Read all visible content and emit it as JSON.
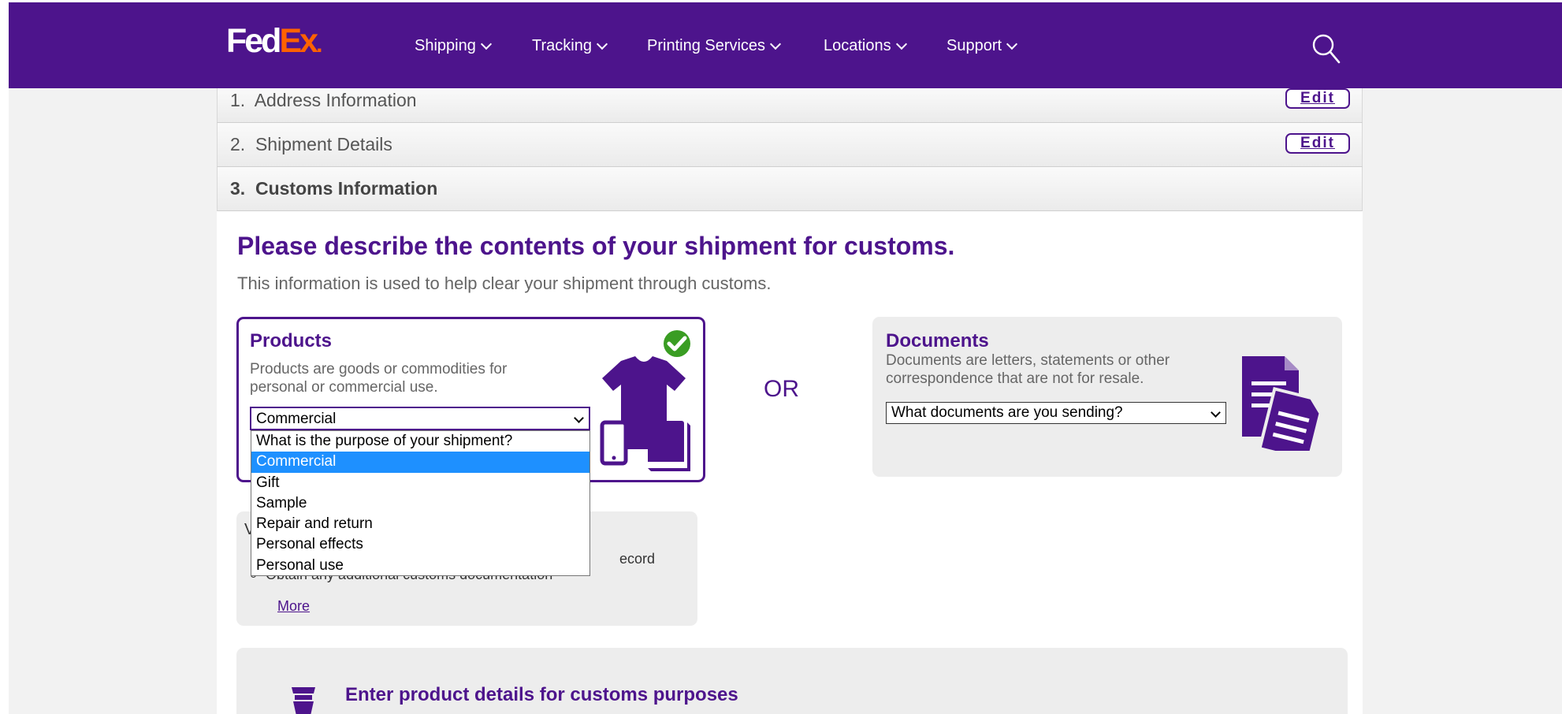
{
  "header": {
    "logo": {
      "fed": "Fed",
      "ex": "Ex",
      "dot": "."
    },
    "nav": [
      "Shipping",
      "Tracking",
      "Printing Services",
      "Locations",
      "Support"
    ],
    "brand_color": "#4d148c",
    "accent_color": "#ff6200",
    "search_icon": "search-icon"
  },
  "steps": [
    {
      "number": "1.",
      "label": "Address Information",
      "action": "Edit"
    },
    {
      "number": "2.",
      "label": "Shipment Details",
      "action": "Edit"
    },
    {
      "number": "3.",
      "label": "Customs Information"
    }
  ],
  "customs": {
    "title": "Please describe the contents of your shipment for customs.",
    "subtitle": "This information is used to help clear your shipment through customs.",
    "or_label": "OR"
  },
  "products": {
    "title": "Products",
    "desc_line1": "Products are goods or commodities for",
    "desc_line2": "personal or commercial use.",
    "select_value": "Commercial",
    "selected": true,
    "icons": [
      "check-icon",
      "tshirt-icon",
      "phone-icon",
      "book-icon"
    ]
  },
  "purpose_dropdown": {
    "options": [
      "What is the purpose of your shipment?",
      "Commercial",
      "Gift",
      "Sample",
      "Repair and return",
      "Personal effects",
      "Personal use"
    ],
    "highlighted": "Commercial"
  },
  "documents": {
    "title": "Documents",
    "desc_line1": "Documents are letters, statements or other",
    "desc_line2": "correspondence that are not for resale.",
    "select_value": "What documents are you sending?"
  },
  "info_box": {
    "partial_letter": "V",
    "bullet1_tail": "ecord",
    "bullet2": "Obtain any additional customs documentation",
    "more_link": "More"
  },
  "product_details": {
    "title": "Enter product details for customs purposes"
  }
}
